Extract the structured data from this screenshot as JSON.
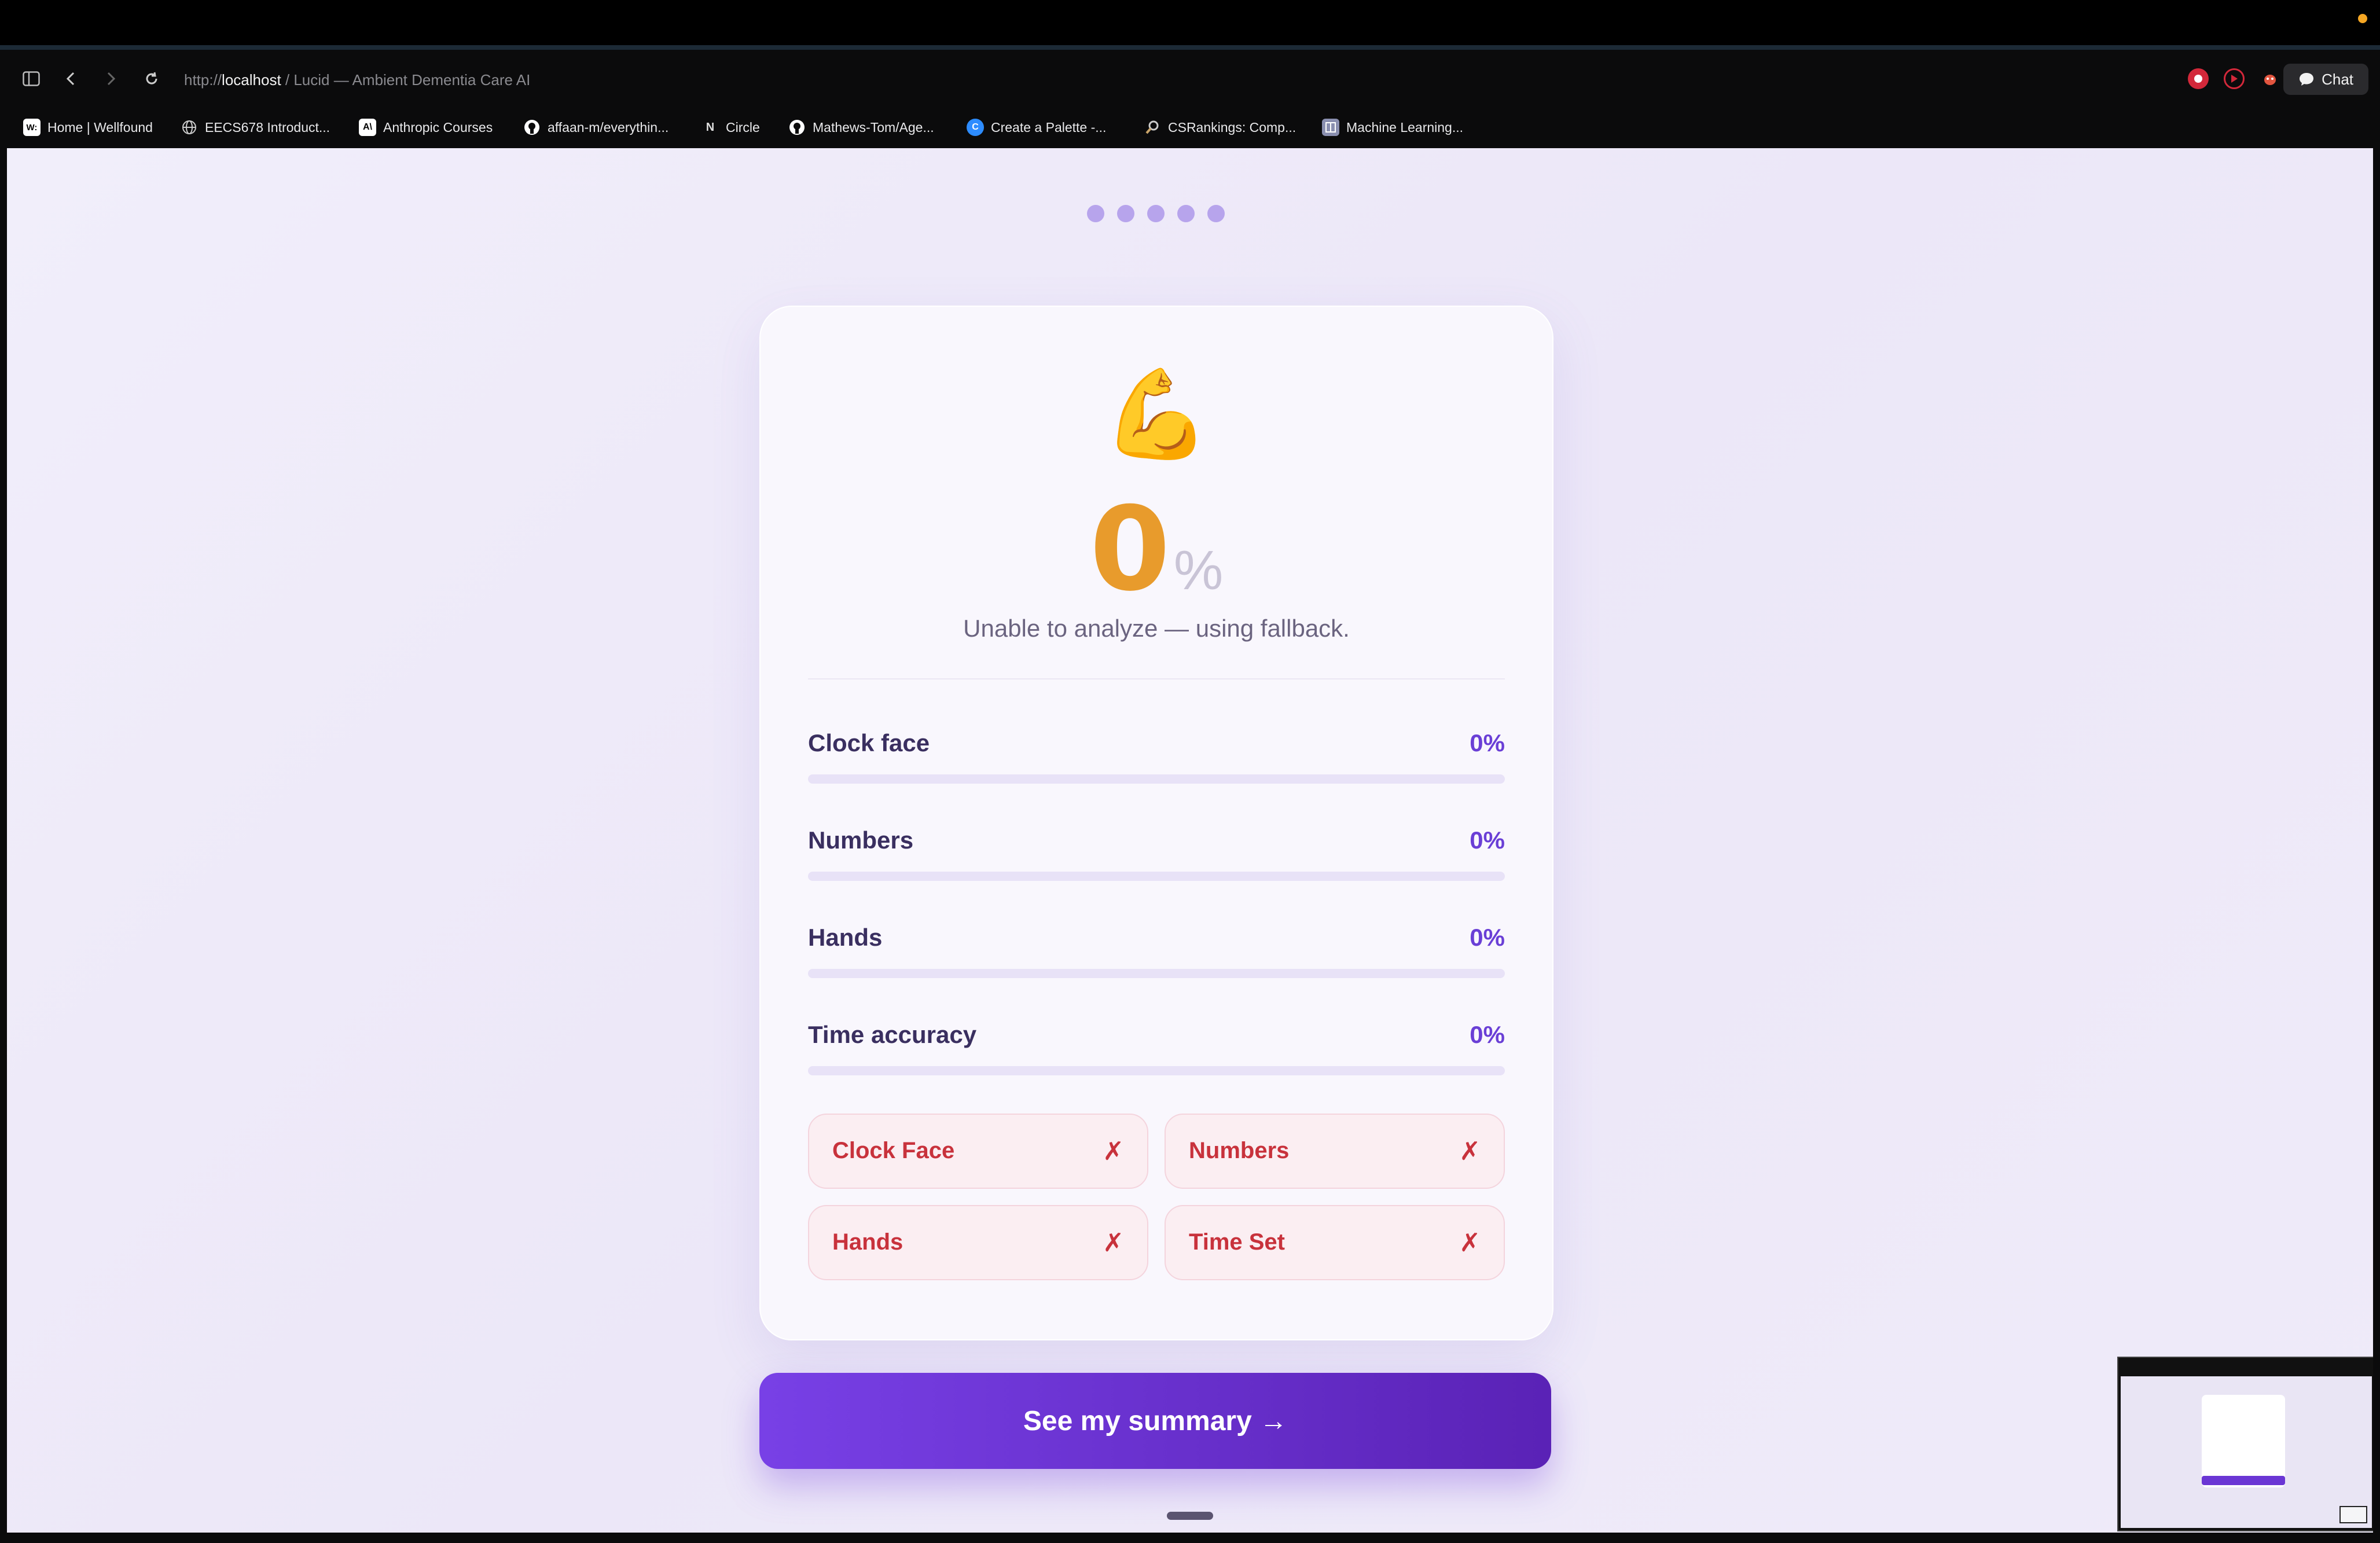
{
  "browser": {
    "url_scheme": "http://",
    "url_host": "localhost",
    "url_title": " / Lucid — Ambient Dementia Care AI",
    "chat_label": "Chat",
    "bookmarks": [
      {
        "label": "Home | Wellfound",
        "icon": "W:"
      },
      {
        "label": "EECS678 Introduct...",
        "icon": "globe"
      },
      {
        "label": "Anthropic Courses",
        "icon": "A\\"
      },
      {
        "label": "affaan-m/everythin...",
        "icon": "github"
      },
      {
        "label": "Circle",
        "icon": "N"
      },
      {
        "label": "Mathews-Tom/Age...",
        "icon": "github"
      },
      {
        "label": "Create a Palette -...",
        "icon": "C"
      },
      {
        "label": "CSRankings: Comp...",
        "icon": "magnifier"
      },
      {
        "label": "Machine Learning...",
        "icon": "book"
      }
    ]
  },
  "result": {
    "emoji": "💪",
    "score": "0",
    "score_unit": "%",
    "message": "Unable to analyze — using fallback.",
    "score_color": "#e89b2c"
  },
  "metrics": [
    {
      "label": "Clock face",
      "value": "0%",
      "fraction": 0
    },
    {
      "label": "Numbers",
      "value": "0%",
      "fraction": 0
    },
    {
      "label": "Hands",
      "value": "0%",
      "fraction": 0
    },
    {
      "label": "Time accuracy",
      "value": "0%",
      "fraction": 0
    }
  ],
  "checks": [
    {
      "label": "Clock Face",
      "mark": "✗"
    },
    {
      "label": "Numbers",
      "mark": "✗"
    },
    {
      "label": "Hands",
      "mark": "✗"
    },
    {
      "label": "Time Set",
      "mark": "✗"
    }
  ],
  "cta_label": "See my summary →",
  "colors": {
    "accent": "#6a3fd6",
    "fail": "#c8323c",
    "warning": "#e89b2c"
  }
}
